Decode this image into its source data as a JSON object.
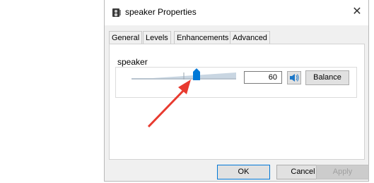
{
  "window": {
    "title": "speaker Properties",
    "close_glyph": "✕",
    "icon": "speaker-icon"
  },
  "tabs": [
    {
      "label": "General",
      "active": false
    },
    {
      "label": "Levels",
      "active": true
    },
    {
      "label": "Enhancements",
      "active": false
    },
    {
      "label": "Advanced",
      "active": false
    }
  ],
  "levels": {
    "group_label": "speaker",
    "volume_value": "60",
    "volume_level": 60,
    "mute_icon": "speaker-volume-icon",
    "balance_label": "Balance"
  },
  "buttons": {
    "ok": "OK",
    "cancel": "Cancel",
    "apply": "Apply"
  },
  "colors": {
    "highlight": "#2a9be8",
    "slider_thumb": "#0078d7",
    "annotation_arrow": "#e83a2f"
  }
}
